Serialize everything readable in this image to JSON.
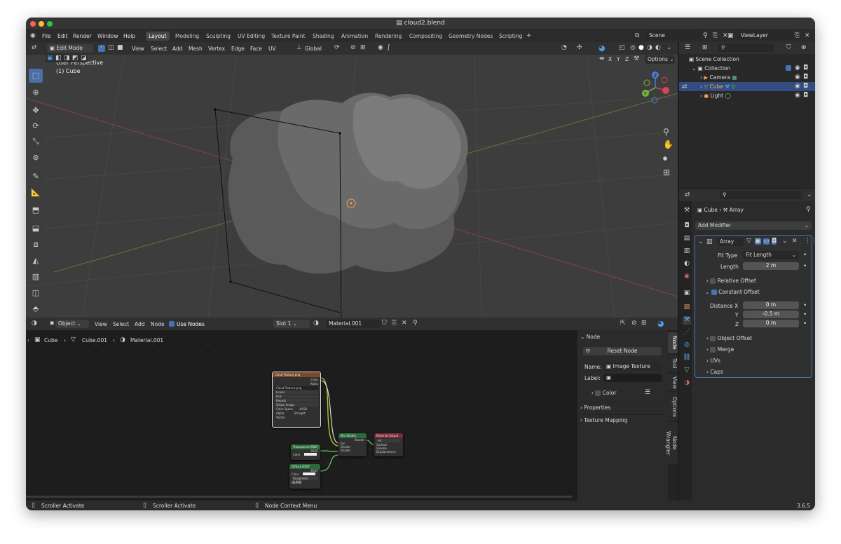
{
  "window": {
    "title": "cloud2.blend"
  },
  "menu": [
    "File",
    "Edit",
    "Render",
    "Window",
    "Help"
  ],
  "workspaces": [
    {
      "label": "Layout",
      "active": true
    },
    {
      "label": "Modeling"
    },
    {
      "label": "Sculpting"
    },
    {
      "label": "UV Editing"
    },
    {
      "label": "Texture Paint"
    },
    {
      "label": "Shading"
    },
    {
      "label": "Animation"
    },
    {
      "label": "Rendering"
    },
    {
      "label": "Compositing"
    },
    {
      "label": "Geometry Nodes"
    },
    {
      "label": "Scripting"
    }
  ],
  "scene": {
    "name": "Scene",
    "view_layer": "ViewLayer"
  },
  "viewport": {
    "mode": "Edit Mode",
    "menu": [
      "View",
      "Select",
      "Add",
      "Mesh",
      "Vertex",
      "Edge",
      "Face",
      "UV"
    ],
    "transform": "Global",
    "options": "Options",
    "axes": [
      "X",
      "Y",
      "Z"
    ],
    "overlay_title": "User Perspective",
    "overlay_sub": "(1) Cube",
    "gizmo": {
      "x": "X",
      "y": "Y",
      "z": "Z"
    }
  },
  "outliner": {
    "search_placeholder": "",
    "items": [
      {
        "label": "Scene Collection",
        "depth": 0
      },
      {
        "label": "Collection",
        "depth": 1
      },
      {
        "label": "Camera",
        "depth": 2
      },
      {
        "label": "Cube",
        "depth": 2,
        "selected": true
      },
      {
        "label": "Light",
        "depth": 2
      }
    ]
  },
  "properties": {
    "breadcrumb": [
      "Cube",
      "Array"
    ],
    "add_modifier": "Add Modifier",
    "modifier_name": "Array",
    "fit_type_label": "Fit Type",
    "fit_type": "Fit Length",
    "length_label": "Length",
    "length": "2 m",
    "relative_offset": "Relative Offset",
    "constant_offset": "Constant Offset",
    "distance_x_label": "Distance X",
    "distance_x": "0 m",
    "y_label": "Y",
    "distance_y": "-0.5 m",
    "z_label": "Z",
    "distance_z": "0 m",
    "object_offset": "Object Offset",
    "merge": "Merge",
    "uvs": "UVs",
    "caps": "Caps"
  },
  "node_editor": {
    "type": "Object",
    "menu": [
      "View",
      "Select",
      "Add",
      "Node"
    ],
    "use_nodes": "Use Nodes",
    "slot": "Slot 1",
    "material": "Material.001",
    "breadcrumb": [
      "Cube",
      "Cube.001",
      "Material.001"
    ],
    "nodes": {
      "image": {
        "title": "Cloud Texture.png",
        "out1": "Color",
        "out2": "Alpha",
        "file": "Cloud Texture.png",
        "rows": [
          "Linear",
          "Flat",
          "Repeat",
          "Single Image",
          "Color Space",
          "Alpha",
          "Vector"
        ],
        "vals": [
          "",
          "",
          "",
          "",
          "sRGB",
          "Straight",
          ""
        ]
      },
      "mix": {
        "title": "Mix Shader",
        "out": "Shader",
        "rows": [
          "Fac",
          "Shader",
          "Shader"
        ]
      },
      "output": {
        "title": "Material Output",
        "mode": "All",
        "rows": [
          "Surface",
          "Volume",
          "Displacement"
        ]
      },
      "transparent": {
        "title": "Transparent BSDF",
        "out": "BSDF",
        "row": "Color"
      },
      "diffuse": {
        "title": "Diffuse BSDF",
        "out": "BSDF",
        "rows": [
          "Color",
          "Roughness",
          "Normal"
        ],
        "roughness": "0.000"
      }
    }
  },
  "node_sidebar": {
    "section": "Node",
    "reset": "Reset Node",
    "name_label": "Name:",
    "name": "Image Texture",
    "label_label": "Label:",
    "label": "",
    "color": "Color",
    "properties": "Properties",
    "texture_mapping": "Texture Mapping",
    "tabs": [
      "Node",
      "Tool",
      "View",
      "Options",
      "Node Wrangler"
    ]
  },
  "status": {
    "left1": "Scroller Activate",
    "left2": "Scroller Activate",
    "mid": "Node Context Menu",
    "version": "3.6.5"
  },
  "colors": {
    "accent": "#4772b3",
    "window_bg": "#1d1d1d",
    "header": "#303030"
  }
}
